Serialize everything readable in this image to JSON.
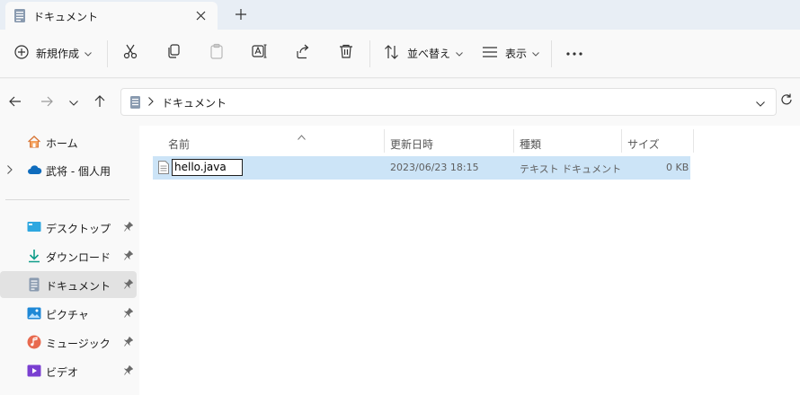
{
  "tab": {
    "title": "ドキュメント"
  },
  "toolbar": {
    "new_label": "新規作成",
    "sort_label": "並べ替え",
    "view_label": "表示",
    "more_label": "···"
  },
  "address": {
    "crumb": "ドキュメント"
  },
  "sidebar": {
    "items": [
      {
        "label": "ホーム",
        "icon": "home-icon"
      },
      {
        "label": "武将 - 個人用",
        "icon": "onedrive-icon"
      },
      {
        "label": "デスクトップ",
        "icon": "desktop-icon"
      },
      {
        "label": "ダウンロード",
        "icon": "download-icon"
      },
      {
        "label": "ドキュメント",
        "icon": "documents-icon"
      },
      {
        "label": "ピクチャ",
        "icon": "pictures-icon"
      },
      {
        "label": "ミュージック",
        "icon": "music-icon"
      },
      {
        "label": "ビデオ",
        "icon": "videos-icon"
      }
    ]
  },
  "columns": {
    "name": "名前",
    "modified": "更新日時",
    "type": "種類",
    "size": "サイズ"
  },
  "files": [
    {
      "name": "hello.java",
      "modified": "2023/06/23 18:15",
      "type": "テキスト ドキュメント",
      "size": "0 KB"
    }
  ],
  "colors": {
    "selection": "#cce4f7",
    "accent": "#0067c0"
  }
}
